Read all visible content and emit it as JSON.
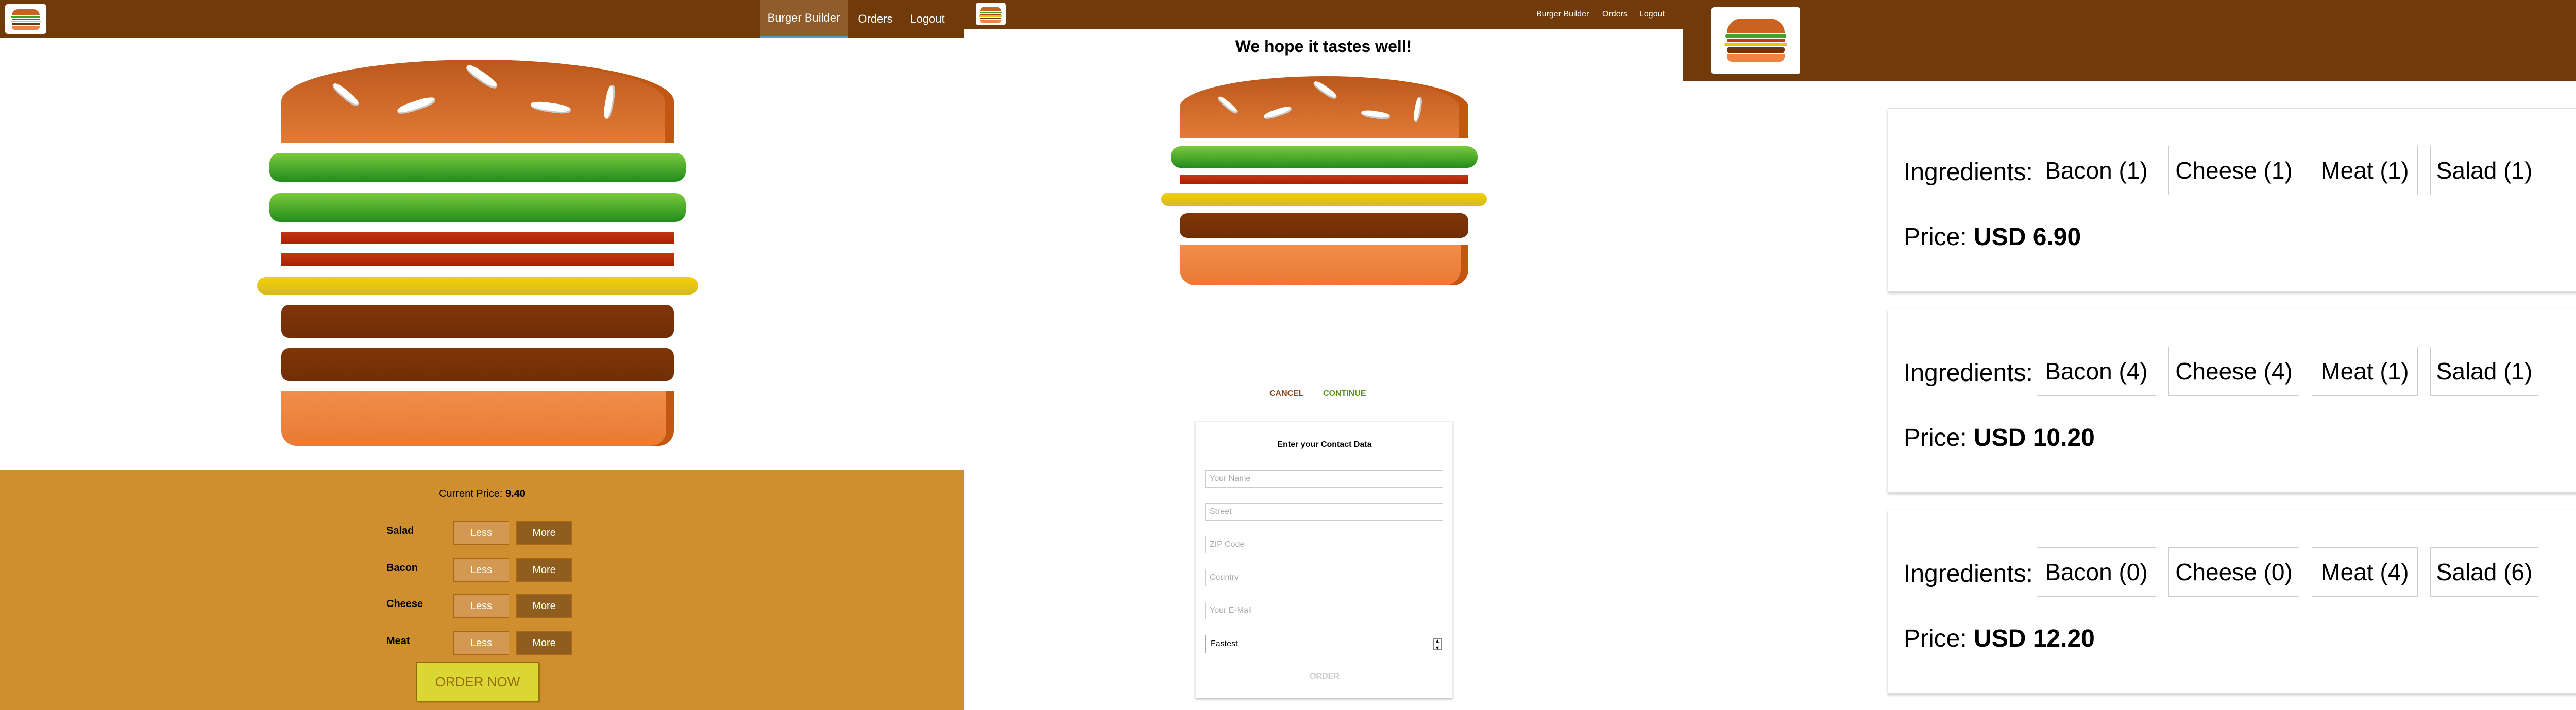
{
  "builder": {
    "nav": {
      "burger_builder": "Burger Builder",
      "orders": "Orders",
      "logout": "Logout"
    },
    "current_price_label": "Current Price:",
    "current_price_value": "9.40",
    "controls": [
      {
        "label": "Salad",
        "less": "Less",
        "more": "More"
      },
      {
        "label": "Bacon",
        "less": "Less",
        "more": "More"
      },
      {
        "label": "Cheese",
        "less": "Less",
        "more": "More"
      },
      {
        "label": "Meat",
        "less": "Less",
        "more": "More"
      }
    ],
    "order_now": "ORDER NOW"
  },
  "checkout": {
    "nav": {
      "burger_builder": "Burger Builder",
      "orders": "Orders",
      "logout": "Logout"
    },
    "heading": "We hope it tastes well!",
    "cancel": "CANCEL",
    "continue": "CONTINUE",
    "contact_title": "Enter your Contact Data",
    "fields": {
      "name_placeholder": "Your Name",
      "street_placeholder": "Street",
      "zip_placeholder": "ZIP Code",
      "country_placeholder": "Country",
      "email_placeholder": "Your E-Mail"
    },
    "delivery_selected": "Fastest",
    "order": "ORDER"
  },
  "orders": {
    "ingredients_label": "Ingredients:",
    "price_label": "Price:",
    "list": [
      {
        "bacon": "Bacon (1)",
        "cheese": "Cheese (1)",
        "meat": "Meat (1)",
        "salad": "Salad (1)",
        "price": "USD 6.90"
      },
      {
        "bacon": "Bacon (4)",
        "cheese": "Cheese (4)",
        "meat": "Meat (1)",
        "salad": "Salad (1)",
        "price": "USD 10.20"
      },
      {
        "bacon": "Bacon (0)",
        "cheese": "Cheese (0)",
        "meat": "Meat (4)",
        "salad": "Salad (6)",
        "price": "USD 12.20"
      }
    ]
  },
  "colors": {
    "toolbar": "#703b09",
    "controls_bg": "#cf8f2e",
    "cancel": "#944317",
    "continue": "#5c9210"
  },
  "icons": [
    "burger-logo-icon",
    "select-arrow-icon"
  ]
}
